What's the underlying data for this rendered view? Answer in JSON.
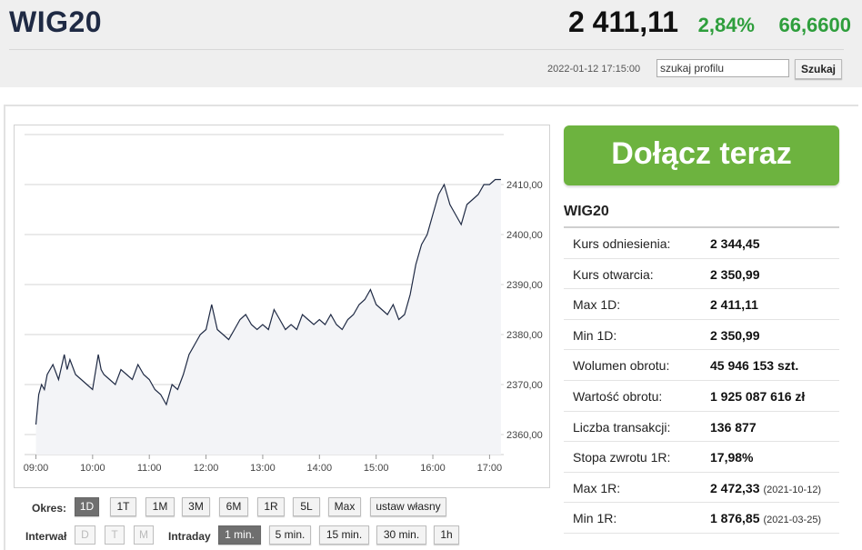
{
  "header": {
    "title": "WIG20",
    "price": "2 411,11",
    "change_pct": "2,84%",
    "change_abs": "66,6600",
    "timestamp": "2022-01-12 17:15:00",
    "search_value": "szukaj profilu",
    "search_button": "Szukaj"
  },
  "chart_data": {
    "type": "area",
    "x_ticks": [
      "09:00",
      "10:00",
      "11:00",
      "12:00",
      "13:00",
      "14:00",
      "15:00",
      "16:00",
      "17:00"
    ],
    "y_ticks": [
      "2360,00",
      "2370,00",
      "2380,00",
      "2390,00",
      "2400,00",
      "2410,00"
    ],
    "ylim": [
      2356,
      2420
    ],
    "grid": true,
    "series": [
      {
        "x": [
          9.0,
          9.05,
          9.1,
          9.15,
          9.2,
          9.3,
          9.4,
          9.5,
          9.55,
          9.6,
          9.7,
          9.8,
          9.9,
          10.0,
          10.1,
          10.15,
          10.2,
          10.3,
          10.4,
          10.5,
          10.6,
          10.7,
          10.8,
          10.9,
          11.0,
          11.1,
          11.2,
          11.3,
          11.4,
          11.5,
          11.6,
          11.7,
          11.8,
          11.9,
          12.0,
          12.1,
          12.2,
          12.3,
          12.4,
          12.5,
          12.6,
          12.7,
          12.8,
          12.9,
          13.0,
          13.1,
          13.2,
          13.3,
          13.4,
          13.5,
          13.6,
          13.7,
          13.8,
          13.9,
          14.0,
          14.1,
          14.2,
          14.3,
          14.4,
          14.5,
          14.6,
          14.7,
          14.8,
          14.9,
          15.0,
          15.1,
          15.2,
          15.3,
          15.4,
          15.5,
          15.6,
          15.7,
          15.8,
          15.9,
          16.0,
          16.1,
          16.2,
          16.3,
          16.4,
          16.5,
          16.6,
          16.7,
          16.8,
          16.9,
          17.0,
          17.1,
          17.2
        ],
        "y": [
          2362,
          2368,
          2370,
          2369,
          2372,
          2374,
          2371,
          2376,
          2373,
          2375,
          2372,
          2371,
          2370,
          2369,
          2376,
          2373,
          2372,
          2371,
          2370,
          2373,
          2372,
          2371,
          2374,
          2372,
          2371,
          2369,
          2368,
          2366,
          2370,
          2369,
          2372,
          2376,
          2378,
          2380,
          2381,
          2386,
          2381,
          2380,
          2379,
          2381,
          2383,
          2384,
          2382,
          2381,
          2382,
          2381,
          2385,
          2383,
          2381,
          2382,
          2381,
          2384,
          2383,
          2382,
          2383,
          2382,
          2384,
          2382,
          2381,
          2383,
          2384,
          2386,
          2387,
          2389,
          2386,
          2385,
          2384,
          2386,
          2383,
          2384,
          2388,
          2394,
          2398,
          2400,
          2404,
          2408,
          2410,
          2406,
          2404,
          2402,
          2406,
          2407,
          2408,
          2410,
          2410,
          2411,
          2411
        ]
      }
    ]
  },
  "controls": {
    "okres_label": "Okres:",
    "okres": [
      "1D",
      "1T",
      "1M",
      "3M",
      "6M",
      "1R",
      "5L",
      "Max",
      "ustaw własny"
    ],
    "interwal_label": "Interwał",
    "interwal": [
      "D",
      "T",
      "M"
    ],
    "intraday_label": "Intraday",
    "intraday": [
      "1 min.",
      "5 min.",
      "15 min.",
      "30 min.",
      "1h"
    ]
  },
  "cta": "Dołącz teraz",
  "info": {
    "title": "WIG20",
    "rows": [
      {
        "k": "Kurs odniesienia:",
        "v": "2 344,45",
        "d": ""
      },
      {
        "k": "Kurs otwarcia:",
        "v": "2 350,99",
        "d": ""
      },
      {
        "k": "Max 1D:",
        "v": "2 411,11",
        "d": ""
      },
      {
        "k": "Min 1D:",
        "v": "2 350,99",
        "d": ""
      },
      {
        "k": "Wolumen obrotu:",
        "v": "45 946 153 szt.",
        "d": ""
      },
      {
        "k": "Wartość obrotu:",
        "v": "1 925 087 616 zł",
        "d": ""
      },
      {
        "k": "Liczba transakcji:",
        "v": "136 877",
        "d": ""
      },
      {
        "k": "Stopa zwrotu 1R:",
        "v": "17,98%",
        "d": ""
      },
      {
        "k": "Max 1R:",
        "v": "2 472,33",
        "d": "(2021-10-12)"
      },
      {
        "k": "Min 1R:",
        "v": "1 876,85",
        "d": "(2021-03-25)"
      }
    ]
  },
  "colors": {
    "accent_green": "#2e9e3c",
    "cta_green": "#6db33f",
    "line": "#1f2a44"
  }
}
